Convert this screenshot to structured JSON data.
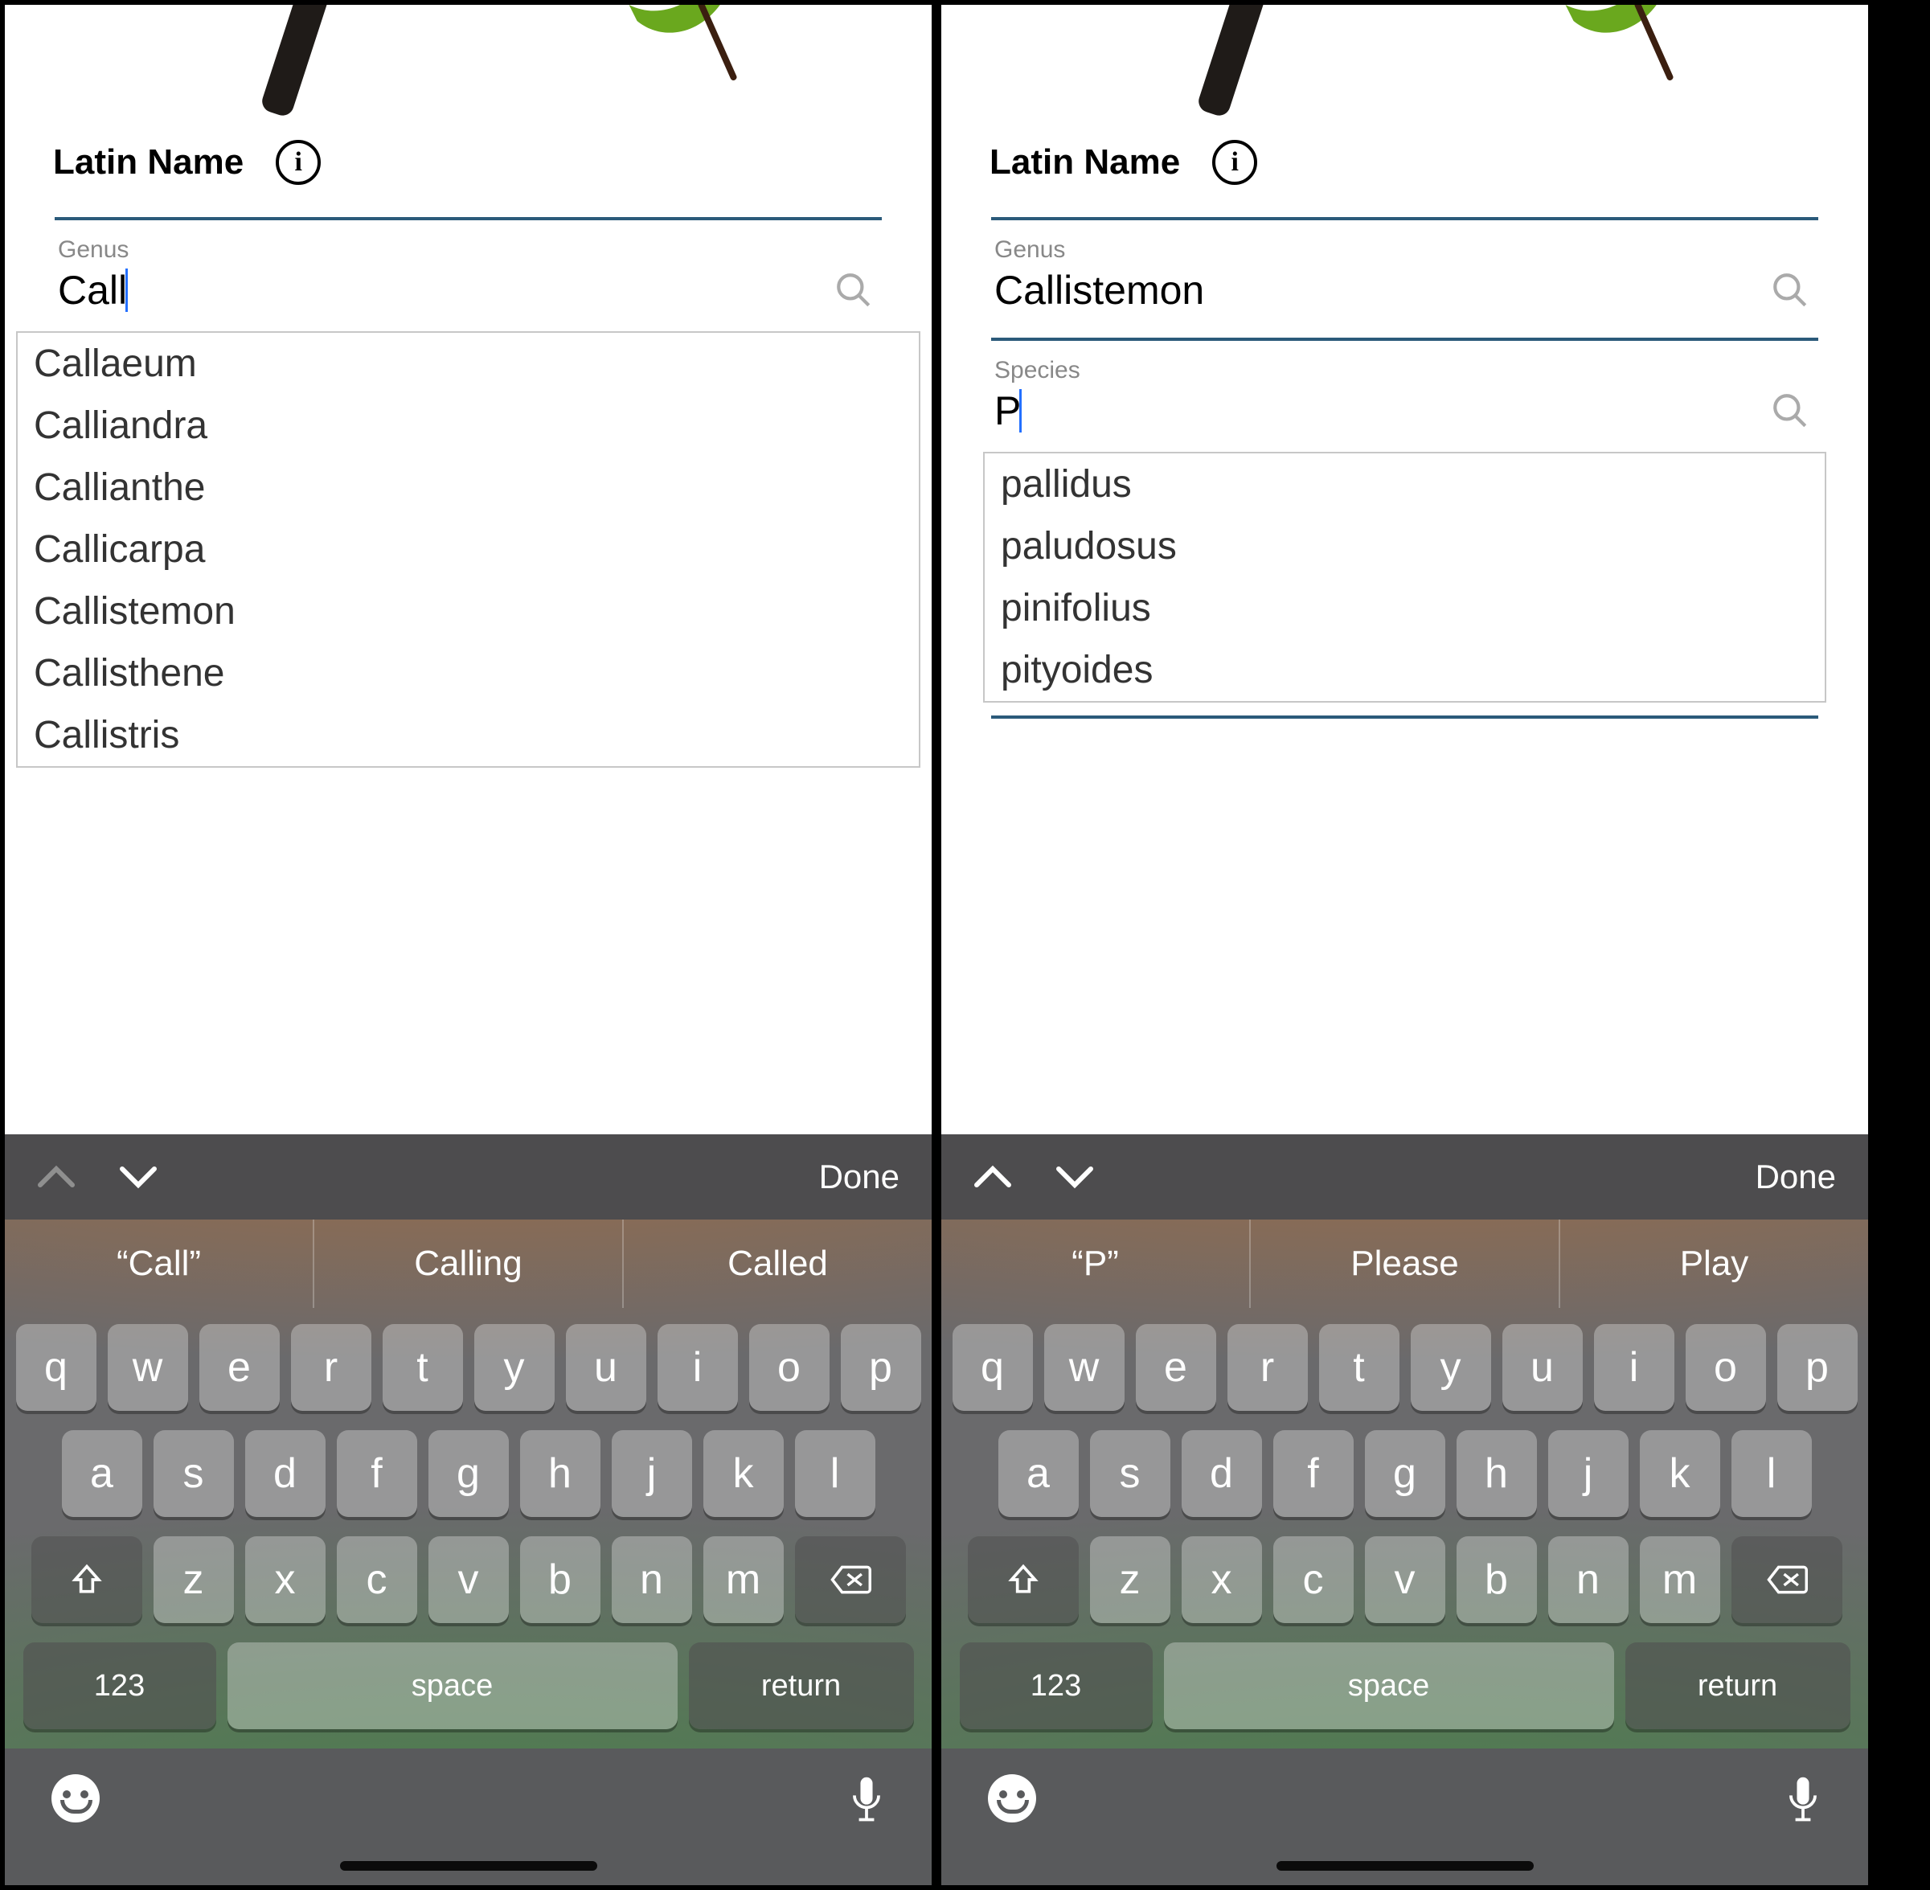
{
  "section_title": "Latin Name",
  "info_glyph": "i",
  "left": {
    "genus": {
      "label": "Genus",
      "value": "Call",
      "suggestions": [
        "Callaeum",
        "Calliandra",
        "Callianthe",
        "Callicarpa",
        "Callistemon",
        "Callisthene",
        "Callistris"
      ]
    },
    "keyboard": {
      "done": "Done",
      "predictions": [
        "“Call”",
        "Calling",
        "Called"
      ],
      "row1": [
        "q",
        "w",
        "e",
        "r",
        "t",
        "y",
        "u",
        "i",
        "o",
        "p"
      ],
      "row2": [
        "a",
        "s",
        "d",
        "f",
        "g",
        "h",
        "j",
        "k",
        "l"
      ],
      "row3": [
        "z",
        "x",
        "c",
        "v",
        "b",
        "n",
        "m"
      ],
      "numkey": "123",
      "space": "space",
      "return": "return"
    }
  },
  "right": {
    "genus": {
      "label": "Genus",
      "value": "Callistemon"
    },
    "species": {
      "label": "Species",
      "value": "P",
      "suggestions": [
        "pallidus",
        "paludosus",
        "pinifolius",
        "pityoides"
      ]
    },
    "keyboard": {
      "done": "Done",
      "predictions": [
        "“P”",
        "Please",
        "Play"
      ],
      "row1": [
        "q",
        "w",
        "e",
        "r",
        "t",
        "y",
        "u",
        "i",
        "o",
        "p"
      ],
      "row2": [
        "a",
        "s",
        "d",
        "f",
        "g",
        "h",
        "j",
        "k",
        "l"
      ],
      "row3": [
        "z",
        "x",
        "c",
        "v",
        "b",
        "n",
        "m"
      ],
      "numkey": "123",
      "space": "space",
      "return": "return"
    }
  }
}
